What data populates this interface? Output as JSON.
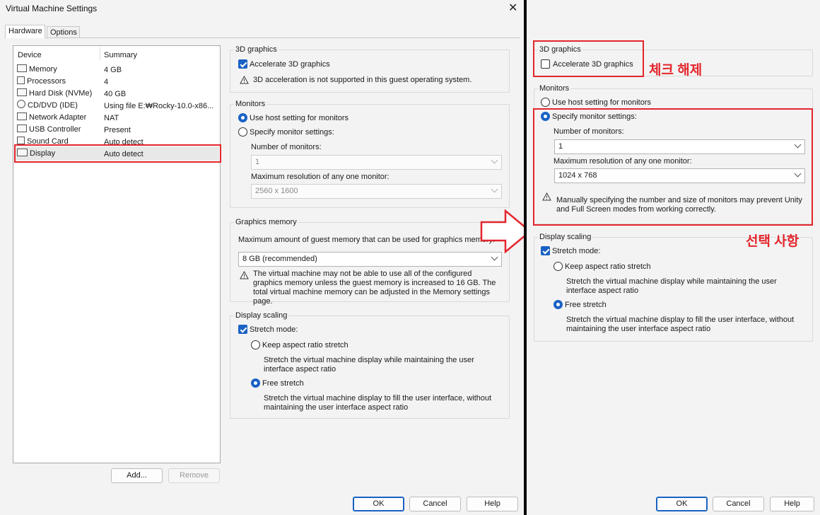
{
  "left_window": {
    "title": "Virtual Machine Settings",
    "tabs": [
      "Hardware",
      "Options"
    ],
    "device_list": {
      "headers": [
        "Device",
        "Summary"
      ],
      "rows": [
        {
          "icon": "memory-icon",
          "device": "Memory",
          "summary": "4 GB"
        },
        {
          "icon": "processor-icon",
          "device": "Processors",
          "summary": "4"
        },
        {
          "icon": "hard-disk-icon",
          "device": "Hard Disk (NVMe)",
          "summary": "40 GB"
        },
        {
          "icon": "cd-dvd-icon",
          "device": "CD/DVD (IDE)",
          "summary": "Using file E:₩Rocky-10.0-x86..."
        },
        {
          "icon": "network-adapter-icon",
          "device": "Network Adapter",
          "summary": "NAT"
        },
        {
          "icon": "usb-controller-icon",
          "device": "USB Controller",
          "summary": "Present"
        },
        {
          "icon": "sound-card-icon",
          "device": "Sound Card",
          "summary": "Auto detect"
        },
        {
          "icon": "display-icon",
          "device": "Display",
          "summary": "Auto detect"
        }
      ],
      "selected": "Display"
    },
    "add_button": "Add...",
    "remove_button": "Remove",
    "graphics3d": {
      "group": "3D graphics",
      "accelerate_label": "Accelerate 3D graphics",
      "accelerate_checked": true,
      "warning": "3D acceleration is not supported in this guest operating system."
    },
    "monitors": {
      "group": "Monitors",
      "use_host_label": "Use host setting for monitors",
      "use_host_selected": true,
      "specify_label": "Specify monitor settings:",
      "number_label": "Number of monitors:",
      "number_value": "1",
      "max_res_label": "Maximum resolution of any one monitor:",
      "max_res_value": "2560 x 1600"
    },
    "graphics_memory": {
      "group": "Graphics memory",
      "label": "Maximum amount of guest memory that can be used for graphics memory:",
      "value": "8 GB (recommended)",
      "warning": "The virtual machine may not be able to use all of the configured graphics memory unless the guest memory is increased to 16 GB. The total virtual machine memory can be adjusted in the Memory settings page."
    },
    "display_scaling": {
      "group": "Display scaling",
      "stretch_label": "Stretch mode:",
      "stretch_checked": true,
      "keep_label": "Keep aspect ratio stretch",
      "keep_desc": "Stretch the virtual machine display while maintaining the user interface aspect ratio",
      "free_label": "Free stretch",
      "free_selected": true,
      "free_desc": "Stretch the virtual machine display to fill the user interface, without maintaining the user interface aspect ratio"
    },
    "footer": {
      "ok": "OK",
      "cancel": "Cancel",
      "help": "Help"
    }
  },
  "right_window": {
    "graphics3d": {
      "group": "3D graphics",
      "accelerate_label": "Accelerate 3D graphics",
      "accelerate_checked": false
    },
    "monitors": {
      "group": "Monitors",
      "use_host_label": "Use host setting for monitors",
      "specify_label": "Specify monitor settings:",
      "specify_selected": true,
      "number_label": "Number of monitors:",
      "number_value": "1",
      "max_res_label": "Maximum resolution of any one monitor:",
      "max_res_value": "1024 x 768",
      "warning": "Manually specifying the number and size of monitors may prevent Unity and Full Screen modes from working correctly."
    },
    "display_scaling": {
      "group": "Display scaling",
      "stretch_label": "Stretch mode:",
      "stretch_checked": true,
      "keep_label": "Keep aspect ratio stretch",
      "keep_desc": "Stretch the virtual machine display while maintaining the user interface aspect ratio",
      "free_label": "Free stretch",
      "free_selected": true,
      "free_desc": "Stretch the virtual machine display to fill the user interface, without maintaining the user interface aspect ratio"
    },
    "footer": {
      "ok": "OK",
      "cancel": "Cancel",
      "help": "Help"
    }
  },
  "annotations": {
    "uncheck": "체크 해제",
    "selection": "선택 사항",
    "accent_color": "#e3262c"
  },
  "colors": {
    "accent": "#1a62c4",
    "annotation": "#e3262c"
  }
}
